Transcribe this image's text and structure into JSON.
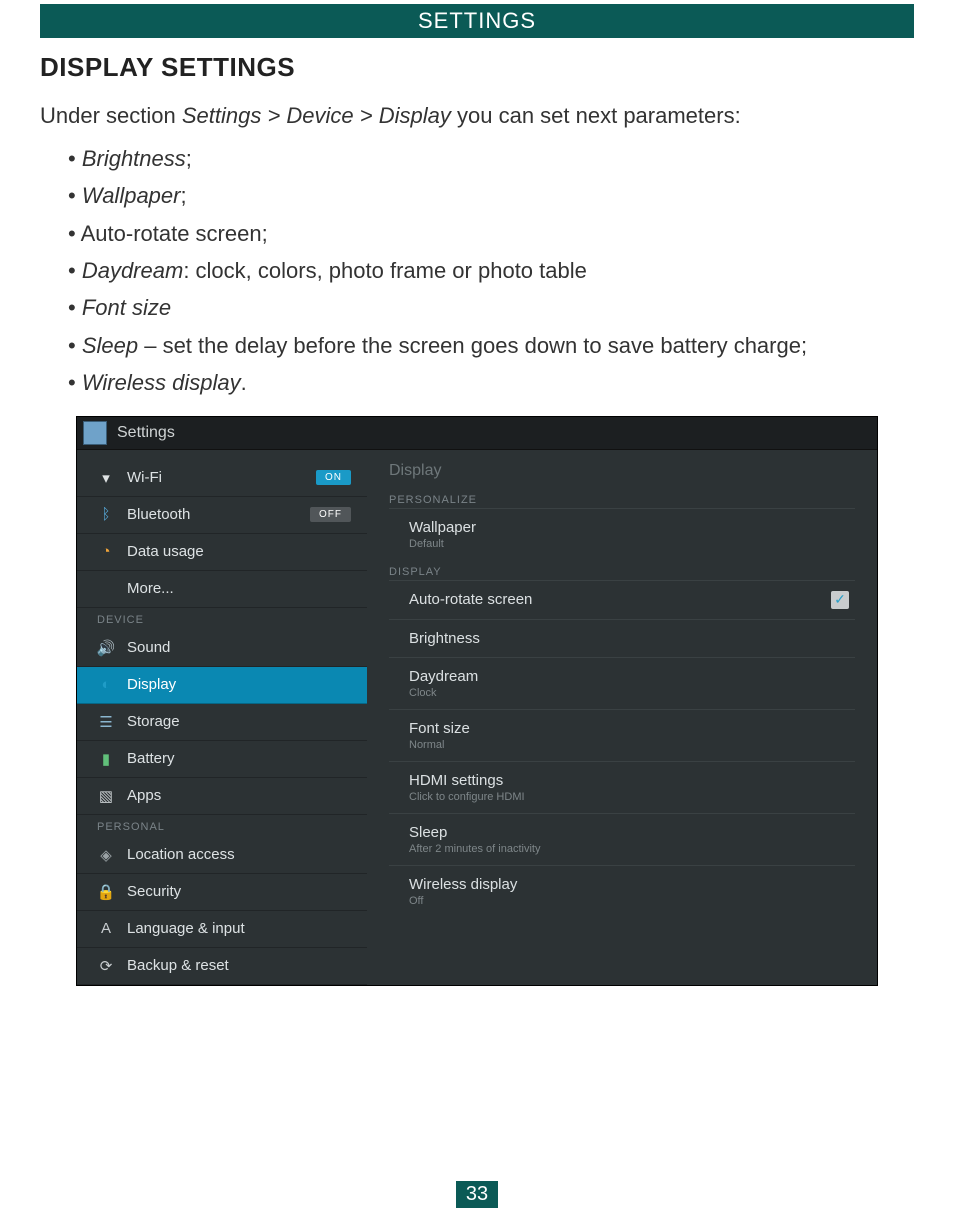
{
  "banner": "SETTINGS",
  "section_title": "DISPLAY SETTINGS",
  "lead_pre": "Under section ",
  "lead_path": "Settings > Device > Display",
  "lead_post": " you can set next parameters:",
  "options": {
    "o1_i": "Brightness",
    "o1_p": ";",
    "o2_i": "Wallpaper",
    "o2_p": ";",
    "o3": "Auto-rotate screen;",
    "o4_i": "Daydream",
    "o4_p": ": clock, colors, photo frame or photo table",
    "o5_i": "Font size",
    "o6_i": "Sleep",
    "o6_p": " – set the delay before the screen goes down to save battery charge;",
    "o7_i": "Wireless display",
    "o7_p": "."
  },
  "screenshot": {
    "titlebar": "Settings",
    "sidebar": {
      "wireless": {
        "wifi": {
          "label": "Wi-Fi",
          "toggle": "ON"
        },
        "bt": {
          "label": "Bluetooth",
          "toggle": "OFF"
        },
        "data": {
          "label": "Data usage"
        },
        "more": {
          "label": "More..."
        }
      },
      "device_header": "DEVICE",
      "device": {
        "sound": {
          "label": "Sound"
        },
        "display": {
          "label": "Display"
        },
        "storage": {
          "label": "Storage"
        },
        "battery": {
          "label": "Battery"
        },
        "apps": {
          "label": "Apps"
        }
      },
      "personal_header": "PERSONAL",
      "personal": {
        "location": {
          "label": "Location access"
        },
        "security": {
          "label": "Security"
        },
        "language": {
          "label": "Language & input"
        },
        "backup": {
          "label": "Backup & reset"
        }
      }
    },
    "content": {
      "title": "Display",
      "cat1": "PERSONALIZE",
      "wallpaper": {
        "title": "Wallpaper",
        "sub": "Default"
      },
      "cat2": "DISPLAY",
      "autorotate": {
        "title": "Auto-rotate screen"
      },
      "brightness": {
        "title": "Brightness"
      },
      "daydream": {
        "title": "Daydream",
        "sub": "Clock"
      },
      "fontsize": {
        "title": "Font size",
        "sub": "Normal"
      },
      "hdmi": {
        "title": "HDMI settings",
        "sub": "Click to configure HDMI"
      },
      "sleep": {
        "title": "Sleep",
        "sub": "After 2 minutes of inactivity"
      },
      "wireless": {
        "title": "Wireless display",
        "sub": "Off"
      }
    }
  },
  "page_number": "33"
}
